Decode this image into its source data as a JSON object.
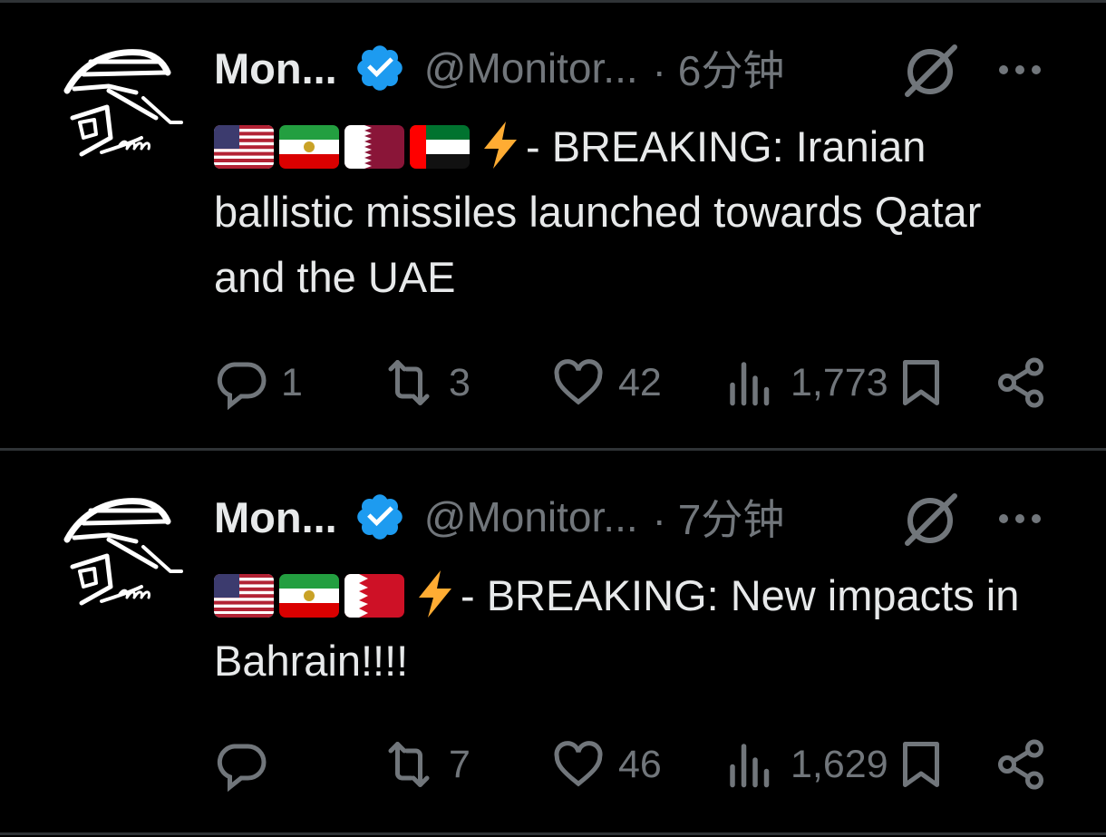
{
  "tweets": [
    {
      "name": "Mon...",
      "handle": "@Monitor...",
      "time": "· 6分钟",
      "flags": [
        "us",
        "iran",
        "qatar",
        "uae"
      ],
      "text": "- BREAKING: Iranian ballistic missiles launched towards Qatar and the UAE",
      "replies": "1",
      "reposts": "3",
      "likes": "42",
      "views": "1,773"
    },
    {
      "name": "Mon...",
      "handle": "@Monitor...",
      "time": "· 7分钟",
      "flags": [
        "us",
        "iran",
        "bahrain"
      ],
      "text": "- BREAKING: New impacts in Bahrain!!!!",
      "replies": "",
      "reposts": "7",
      "likes": "46",
      "views": "1,629"
    }
  ],
  "icons": {
    "verified": "verified-badge-icon",
    "grok": "grok-icon",
    "more": "more-icon",
    "reply": "reply-icon",
    "repost": "repost-icon",
    "like": "like-icon",
    "views": "views-icon",
    "bookmark": "bookmark-icon",
    "share": "share-icon"
  },
  "colors": {
    "background": "#000000",
    "text": "#e7e9ea",
    "muted": "#71767b",
    "verified": "#1d9bf0",
    "divider": "#2f3336",
    "bolt": "#ffac33"
  }
}
